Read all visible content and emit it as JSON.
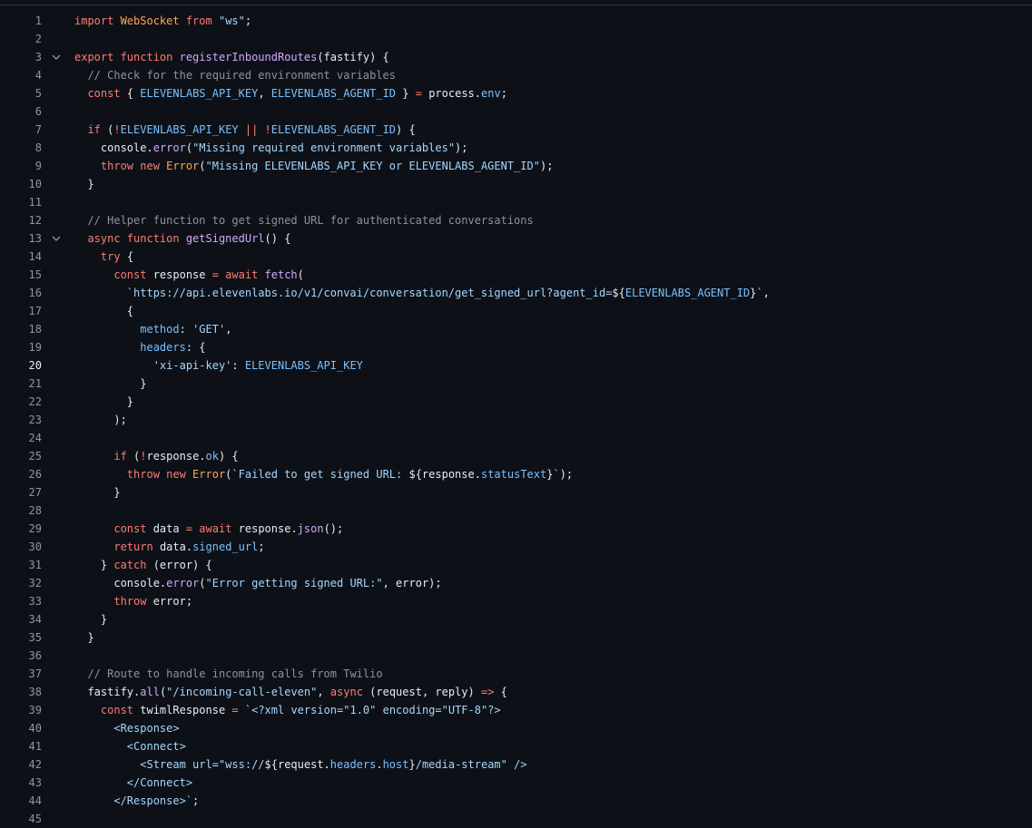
{
  "editor": {
    "active_line": 20,
    "lines": [
      {
        "n": "1",
        "tokens": [
          [
            "kw",
            "import "
          ],
          [
            "cl",
            "WebSocket"
          ],
          [
            "kw",
            " from "
          ],
          [
            "st",
            "\"ws\""
          ],
          [
            "tx",
            ";"
          ]
        ]
      },
      {
        "n": "2",
        "tokens": []
      },
      {
        "n": "3",
        "fold": true,
        "tokens": [
          [
            "kw",
            "export function "
          ],
          [
            "fn",
            "registerInboundRoutes"
          ],
          [
            "tx",
            "(fastify) {"
          ]
        ]
      },
      {
        "n": "4",
        "tokens": [
          [
            "tx",
            "  "
          ],
          [
            "cm",
            "// Check for the required environment variables"
          ]
        ]
      },
      {
        "n": "5",
        "tokens": [
          [
            "tx",
            "  "
          ],
          [
            "kw",
            "const"
          ],
          [
            "tx",
            " { "
          ],
          [
            "cn",
            "ELEVENLABS_API_KEY"
          ],
          [
            "tx",
            ", "
          ],
          [
            "cn",
            "ELEVENLABS_AGENT_ID"
          ],
          [
            "tx",
            " } "
          ],
          [
            "kw",
            "="
          ],
          [
            "tx",
            " process."
          ],
          [
            "cn",
            "env"
          ],
          [
            "tx",
            ";"
          ]
        ]
      },
      {
        "n": "6",
        "tokens": []
      },
      {
        "n": "7",
        "tokens": [
          [
            "tx",
            "  "
          ],
          [
            "kw",
            "if"
          ],
          [
            "tx",
            " ("
          ],
          [
            "kw",
            "!"
          ],
          [
            "cn",
            "ELEVENLABS_API_KEY"
          ],
          [
            "kw",
            " || !"
          ],
          [
            "cn",
            "ELEVENLABS_AGENT_ID"
          ],
          [
            "tx",
            ") {"
          ]
        ]
      },
      {
        "n": "8",
        "tokens": [
          [
            "tx",
            "    console."
          ],
          [
            "fn",
            "error"
          ],
          [
            "tx",
            "("
          ],
          [
            "st",
            "\"Missing required environment variables\""
          ],
          [
            "tx",
            ");"
          ]
        ]
      },
      {
        "n": "9",
        "tokens": [
          [
            "tx",
            "    "
          ],
          [
            "kw",
            "throw new "
          ],
          [
            "cl",
            "Error"
          ],
          [
            "tx",
            "("
          ],
          [
            "st",
            "\"Missing ELEVENLABS_API_KEY or ELEVENLABS_AGENT_ID\""
          ],
          [
            "tx",
            ");"
          ]
        ]
      },
      {
        "n": "10",
        "tokens": [
          [
            "tx",
            "  }"
          ]
        ]
      },
      {
        "n": "11",
        "tokens": []
      },
      {
        "n": "12",
        "tokens": [
          [
            "tx",
            "  "
          ],
          [
            "cm",
            "// Helper function to get signed URL for authenticated conversations"
          ]
        ]
      },
      {
        "n": "13",
        "fold": true,
        "tokens": [
          [
            "tx",
            "  "
          ],
          [
            "kw",
            "async function "
          ],
          [
            "fn",
            "getSignedUrl"
          ],
          [
            "tx",
            "() {"
          ]
        ]
      },
      {
        "n": "14",
        "tokens": [
          [
            "tx",
            "    "
          ],
          [
            "kw",
            "try"
          ],
          [
            "tx",
            " {"
          ]
        ]
      },
      {
        "n": "15",
        "tokens": [
          [
            "tx",
            "      "
          ],
          [
            "kw",
            "const"
          ],
          [
            "tx",
            " response "
          ],
          [
            "kw",
            "= await "
          ],
          [
            "fn",
            "fetch"
          ],
          [
            "tx",
            "("
          ]
        ]
      },
      {
        "n": "16",
        "tokens": [
          [
            "tx",
            "        "
          ],
          [
            "st",
            "`https://api.elevenlabs.io/v1/convai/conversation/get_signed_url?agent_id="
          ],
          [
            "tx",
            "${"
          ],
          [
            "cn",
            "ELEVENLABS_AGENT_ID"
          ],
          [
            "tx",
            "}"
          ],
          [
            "st",
            "`"
          ],
          [
            "tx",
            ","
          ]
        ]
      },
      {
        "n": "17",
        "tokens": [
          [
            "tx",
            "        {"
          ]
        ]
      },
      {
        "n": "18",
        "tokens": [
          [
            "tx",
            "          "
          ],
          [
            "cn",
            "method"
          ],
          [
            "tx",
            ": "
          ],
          [
            "st",
            "'GET'"
          ],
          [
            "tx",
            ","
          ]
        ]
      },
      {
        "n": "19",
        "tokens": [
          [
            "tx",
            "          "
          ],
          [
            "cn",
            "headers"
          ],
          [
            "tx",
            ": {"
          ]
        ]
      },
      {
        "n": "20",
        "tokens": [
          [
            "tx",
            "            "
          ],
          [
            "st",
            "'xi-api-key'"
          ],
          [
            "tx",
            ": "
          ],
          [
            "cn",
            "ELEVENLABS_API_KEY"
          ]
        ]
      },
      {
        "n": "21",
        "tokens": [
          [
            "tx",
            "          }"
          ]
        ]
      },
      {
        "n": "22",
        "tokens": [
          [
            "tx",
            "        }"
          ]
        ]
      },
      {
        "n": "23",
        "tokens": [
          [
            "tx",
            "      );"
          ]
        ]
      },
      {
        "n": "24",
        "tokens": []
      },
      {
        "n": "25",
        "tokens": [
          [
            "tx",
            "      "
          ],
          [
            "kw",
            "if"
          ],
          [
            "tx",
            " ("
          ],
          [
            "kw",
            "!"
          ],
          [
            "tx",
            "response."
          ],
          [
            "cn",
            "ok"
          ],
          [
            "tx",
            ") {"
          ]
        ]
      },
      {
        "n": "26",
        "tokens": [
          [
            "tx",
            "        "
          ],
          [
            "kw",
            "throw new "
          ],
          [
            "cl",
            "Error"
          ],
          [
            "tx",
            "("
          ],
          [
            "st",
            "`Failed to get signed URL: "
          ],
          [
            "tx",
            "${response."
          ],
          [
            "cn",
            "statusText"
          ],
          [
            "tx",
            "}"
          ],
          [
            "st",
            "`"
          ],
          [
            "tx",
            ");"
          ]
        ]
      },
      {
        "n": "27",
        "tokens": [
          [
            "tx",
            "      }"
          ]
        ]
      },
      {
        "n": "28",
        "tokens": []
      },
      {
        "n": "29",
        "tokens": [
          [
            "tx",
            "      "
          ],
          [
            "kw",
            "const"
          ],
          [
            "tx",
            " data "
          ],
          [
            "kw",
            "= await"
          ],
          [
            "tx",
            " response."
          ],
          [
            "fn",
            "json"
          ],
          [
            "tx",
            "();"
          ]
        ]
      },
      {
        "n": "30",
        "tokens": [
          [
            "tx",
            "      "
          ],
          [
            "kw",
            "return"
          ],
          [
            "tx",
            " data."
          ],
          [
            "cn",
            "signed_url"
          ],
          [
            "tx",
            ";"
          ]
        ]
      },
      {
        "n": "31",
        "tokens": [
          [
            "tx",
            "    } "
          ],
          [
            "kw",
            "catch"
          ],
          [
            "tx",
            " (error) {"
          ]
        ]
      },
      {
        "n": "32",
        "tokens": [
          [
            "tx",
            "      console."
          ],
          [
            "fn",
            "error"
          ],
          [
            "tx",
            "("
          ],
          [
            "st",
            "\"Error getting signed URL:\""
          ],
          [
            "tx",
            ", error);"
          ]
        ]
      },
      {
        "n": "33",
        "tokens": [
          [
            "tx",
            "      "
          ],
          [
            "kw",
            "throw"
          ],
          [
            "tx",
            " error;"
          ]
        ]
      },
      {
        "n": "34",
        "tokens": [
          [
            "tx",
            "    }"
          ]
        ]
      },
      {
        "n": "35",
        "tokens": [
          [
            "tx",
            "  }"
          ]
        ]
      },
      {
        "n": "36",
        "tokens": []
      },
      {
        "n": "37",
        "tokens": [
          [
            "tx",
            "  "
          ],
          [
            "cm",
            "// Route to handle incoming calls from Twilio"
          ]
        ]
      },
      {
        "n": "38",
        "tokens": [
          [
            "tx",
            "  fastify."
          ],
          [
            "fn",
            "all"
          ],
          [
            "tx",
            "("
          ],
          [
            "st",
            "\"/incoming-call-eleven\""
          ],
          [
            "tx",
            ", "
          ],
          [
            "kw",
            "async"
          ],
          [
            "tx",
            " (request, reply) "
          ],
          [
            "kw",
            "=>"
          ],
          [
            "tx",
            " {"
          ]
        ]
      },
      {
        "n": "39",
        "tokens": [
          [
            "tx",
            "    "
          ],
          [
            "kw",
            "const"
          ],
          [
            "tx",
            " twimlResponse "
          ],
          [
            "kw",
            "="
          ],
          [
            "tx",
            " "
          ],
          [
            "st",
            "`<?xml version=\"1.0\" encoding=\"UTF-8\"?>"
          ]
        ]
      },
      {
        "n": "40",
        "tokens": [
          [
            "st",
            "      <Response>"
          ]
        ]
      },
      {
        "n": "41",
        "tokens": [
          [
            "st",
            "        <Connect>"
          ]
        ]
      },
      {
        "n": "42",
        "tokens": [
          [
            "st",
            "          <Stream url=\"wss://"
          ],
          [
            "tx",
            "${request."
          ],
          [
            "cn",
            "headers"
          ],
          [
            "tx",
            "."
          ],
          [
            "cn",
            "host"
          ],
          [
            "tx",
            "}"
          ],
          [
            "st",
            "/media-stream\" />"
          ]
        ]
      },
      {
        "n": "43",
        "tokens": [
          [
            "st",
            "        </Connect>"
          ]
        ]
      },
      {
        "n": "44",
        "tokens": [
          [
            "st",
            "      </Response>`"
          ],
          [
            "tx",
            ";"
          ]
        ]
      },
      {
        "n": "45",
        "tokens": []
      }
    ]
  }
}
